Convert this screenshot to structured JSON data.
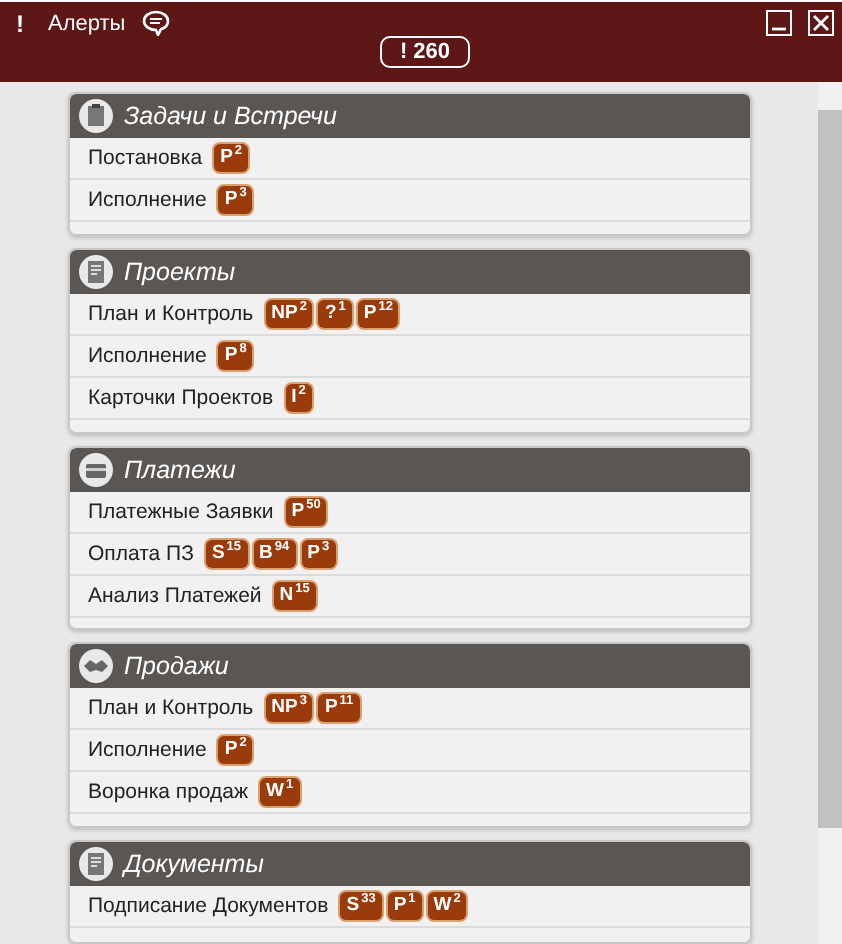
{
  "header": {
    "exclamation": "!",
    "title": "Алерты",
    "total": "! 260"
  },
  "sections": [
    {
      "title": "Задачи и Встречи",
      "items": [
        {
          "label": "Постановка",
          "badges": [
            {
              "letter": "P",
              "count": "2"
            }
          ]
        },
        {
          "label": "Исполнение",
          "badges": [
            {
              "letter": "P",
              "count": "3"
            }
          ]
        }
      ]
    },
    {
      "title": "Проекты",
      "items": [
        {
          "label": "План и Контроль",
          "badges": [
            {
              "letter": "NP",
              "count": "2"
            },
            {
              "letter": "?",
              "count": "1"
            },
            {
              "letter": "P",
              "count": "12"
            }
          ]
        },
        {
          "label": "Исполнение",
          "badges": [
            {
              "letter": "P",
              "count": "8"
            }
          ]
        },
        {
          "label": "Карточки Проектов",
          "badges": [
            {
              "letter": "I",
              "count": "2"
            }
          ]
        }
      ]
    },
    {
      "title": "Платежи",
      "items": [
        {
          "label": "Платежные Заявки",
          "badges": [
            {
              "letter": "P",
              "count": "50"
            }
          ]
        },
        {
          "label": "Оплата ПЗ",
          "badges": [
            {
              "letter": "S",
              "count": "15"
            },
            {
              "letter": "B",
              "count": "94"
            },
            {
              "letter": "P",
              "count": "3"
            }
          ]
        },
        {
          "label": "Анализ Платежей",
          "badges": [
            {
              "letter": "N",
              "count": "15"
            }
          ]
        }
      ]
    },
    {
      "title": "Продажи",
      "items": [
        {
          "label": "План и Контроль",
          "badges": [
            {
              "letter": "NP",
              "count": "3"
            },
            {
              "letter": "P",
              "count": "11"
            }
          ]
        },
        {
          "label": "Исполнение",
          "badges": [
            {
              "letter": "P",
              "count": "2"
            }
          ]
        },
        {
          "label": "Воронка продаж",
          "badges": [
            {
              "letter": "W",
              "count": "1"
            }
          ]
        }
      ]
    },
    {
      "title": "Документы",
      "items": [
        {
          "label": "Подписание Документов",
          "badges": [
            {
              "letter": "S",
              "count": "33"
            },
            {
              "letter": "P",
              "count": "1"
            },
            {
              "letter": "W",
              "count": "2"
            }
          ]
        }
      ]
    }
  ]
}
